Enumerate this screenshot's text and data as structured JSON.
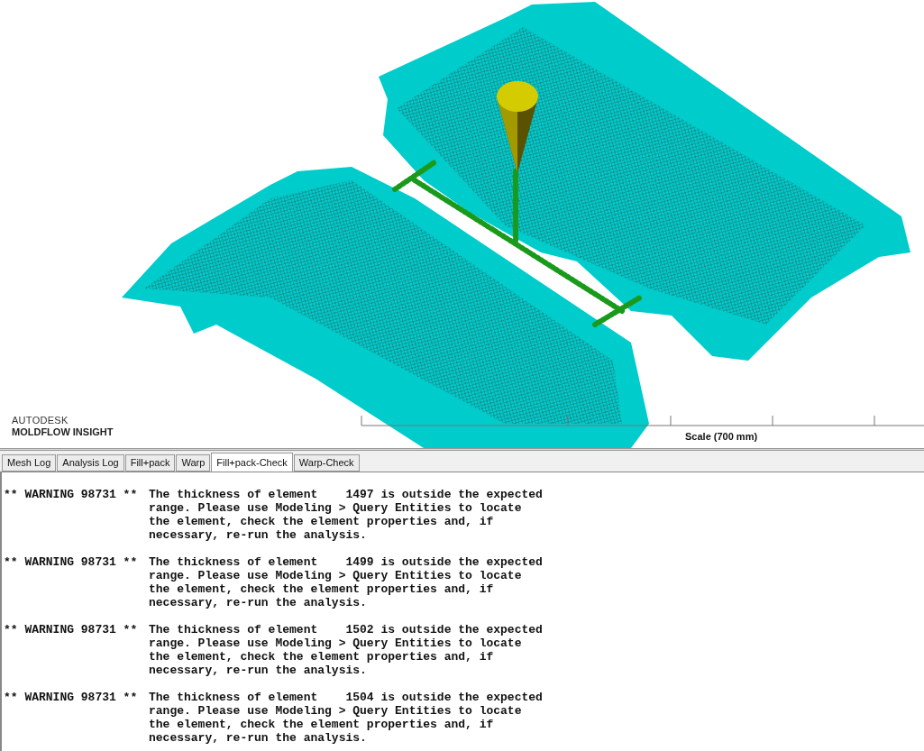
{
  "viewport": {
    "logo": {
      "brand": "AUTODESK",
      "product": "MOLDFLOW",
      "edition": "INSIGHT"
    },
    "scale": {
      "label": "Scale (700 mm)"
    }
  },
  "tabs": [
    {
      "label": "Mesh Log",
      "selected": false
    },
    {
      "label": "Analysis Log",
      "selected": false
    },
    {
      "label": "Fill+pack",
      "selected": false
    },
    {
      "label": "Warp",
      "selected": false
    },
    {
      "label": "Fill+pack-Check",
      "selected": true
    },
    {
      "label": "Warp-Check",
      "selected": false
    }
  ],
  "log": [
    {
      "prefix": "** WARNING 98731 **",
      "lines": [
        "The thickness of element    1497 is outside the expected",
        "range. Please use Modeling > Query Entities to locate",
        "the element, check the element properties and, if",
        "necessary, re-run the analysis."
      ]
    },
    {
      "prefix": "** WARNING 98731 **",
      "lines": [
        "The thickness of element    1499 is outside the expected",
        "range. Please use Modeling > Query Entities to locate",
        "the element, check the element properties and, if",
        "necessary, re-run the analysis."
      ]
    },
    {
      "prefix": "** WARNING 98731 **",
      "lines": [
        "The thickness of element    1502 is outside the expected",
        "range. Please use Modeling > Query Entities to locate",
        "the element, check the element properties and, if",
        "necessary, re-run the analysis."
      ]
    },
    {
      "prefix": "** WARNING 98731 **",
      "lines": [
        "The thickness of element    1504 is outside the expected",
        "range. Please use Modeling > Query Entities to locate",
        "the element, check the element properties and, if",
        "necessary, re-run the analysis."
      ]
    }
  ]
}
